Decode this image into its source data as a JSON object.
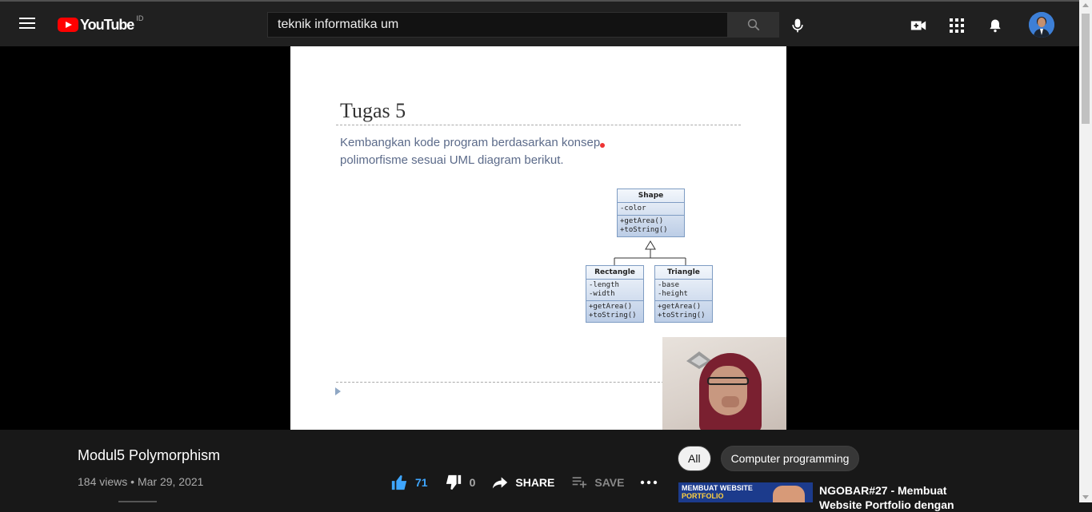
{
  "header": {
    "logo_text": "YouTube",
    "country_code": "ID",
    "search_value": "teknik informatika um"
  },
  "slide": {
    "title": "Tugas 5",
    "body_line1": "Kembangkan kode program berdasarkan konsep",
    "body_line2": "polimorfisme sesuai UML diagram berikut."
  },
  "uml": {
    "shape": {
      "name": "Shape",
      "attrs": "-color",
      "methods": [
        "+getArea()",
        "+toString()"
      ]
    },
    "rectangle": {
      "name": "Rectangle",
      "attrs": [
        "-length",
        "-width"
      ],
      "methods": [
        "+getArea()",
        "+toString()"
      ]
    },
    "triangle": {
      "name": "Triangle",
      "attrs": [
        "-base",
        "-height"
      ],
      "methods": [
        "+getArea()",
        "+toString()"
      ]
    }
  },
  "video": {
    "title": "Modul5 Polymorphism",
    "views": "184 views",
    "date": "Mar 29, 2021",
    "separator": "•"
  },
  "actions": {
    "likes": "71",
    "dislikes": "0",
    "share_label": "SHARE",
    "save_label": "SAVE"
  },
  "chips": [
    "All",
    "Computer programming"
  ],
  "recommendation": {
    "thumb_text_1": "MEMBUAT WEBSITE",
    "thumb_text_2": "PORTFOLIO",
    "title": "NGOBAR#27 - Membuat Website Portfolio dengan"
  },
  "colors": {
    "brand_red": "#ff0000",
    "like_blue": "#3ea6ff",
    "background": "#181818"
  }
}
